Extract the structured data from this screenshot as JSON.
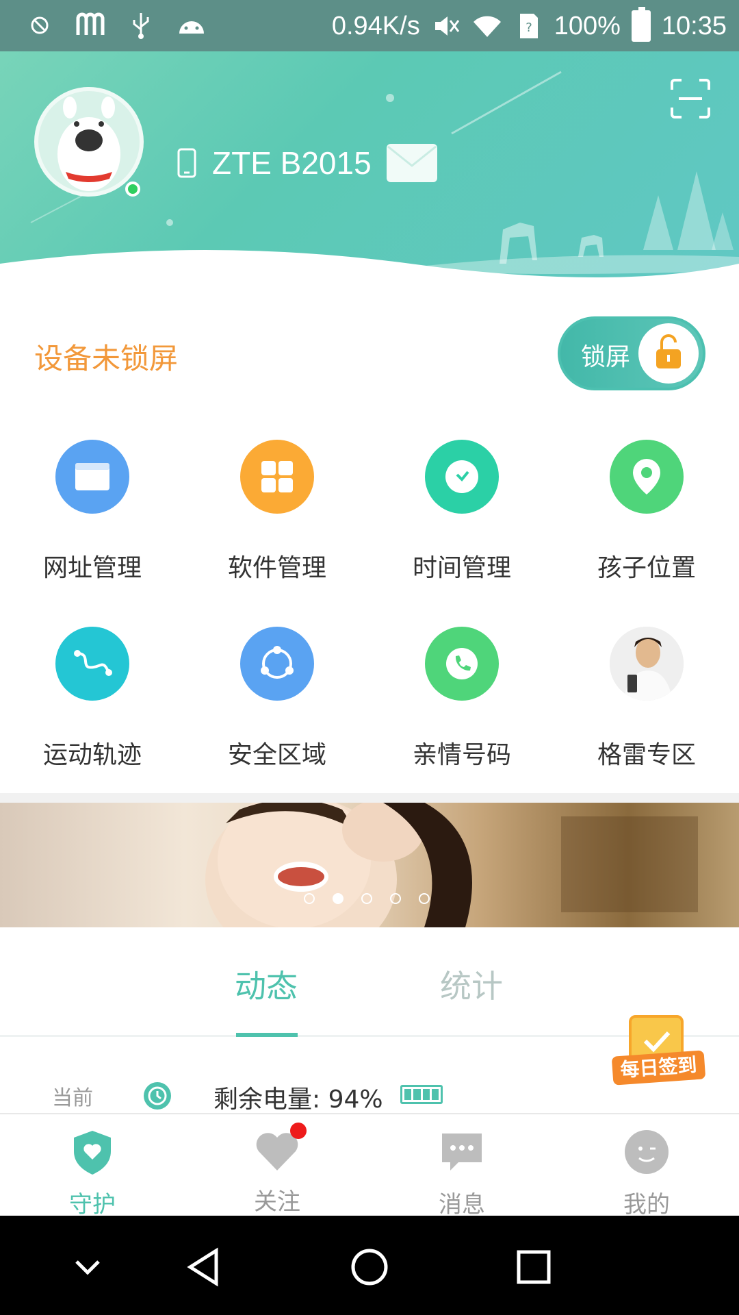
{
  "status_bar": {
    "speed": "0.94K/s",
    "battery": "100%",
    "time": "10:35"
  },
  "header": {
    "device_name": "ZTE B2015"
  },
  "lock": {
    "status_text": "设备未锁屏",
    "toggle_label": "锁屏"
  },
  "features": [
    {
      "label": "网址管理",
      "icon": "browser-icon",
      "color": "#5aa3f2"
    },
    {
      "label": "软件管理",
      "icon": "apps-icon",
      "color": "#fbaa35"
    },
    {
      "label": "时间管理",
      "icon": "clock-icon",
      "color": "#2bd0a6"
    },
    {
      "label": "孩子位置",
      "icon": "location-pin-icon",
      "color": "#4fd57a"
    },
    {
      "label": "运动轨迹",
      "icon": "route-icon",
      "color": "#24c6d4"
    },
    {
      "label": "安全区域",
      "icon": "safe-zone-icon",
      "color": "#5aa3f2"
    },
    {
      "label": "亲情号码",
      "icon": "phone-icon",
      "color": "#4fd57a"
    },
    {
      "label": "格雷专区",
      "icon": "promo-avatar",
      "color": "#e9e9e9"
    }
  ],
  "banner": {
    "slides": 5,
    "active_index": 1
  },
  "tabs": [
    {
      "label": "动态",
      "active": true
    },
    {
      "label": "统计",
      "active": false
    }
  ],
  "checkin": {
    "label": "每日签到"
  },
  "current": {
    "label": "当前",
    "battery_text": "剩余电量: 94%"
  },
  "bottom_nav": [
    {
      "label": "守护",
      "icon": "shield-heart-icon",
      "active": true
    },
    {
      "label": "关注",
      "icon": "heart-icon",
      "active": false,
      "badge": true
    },
    {
      "label": "消息",
      "icon": "chat-bubble-icon",
      "active": false
    },
    {
      "label": "我的",
      "icon": "profile-face-icon",
      "active": false
    }
  ],
  "colors": {
    "accent": "#4ec2ad",
    "warning": "#f2983a",
    "status_bar": "#5d8f88"
  }
}
